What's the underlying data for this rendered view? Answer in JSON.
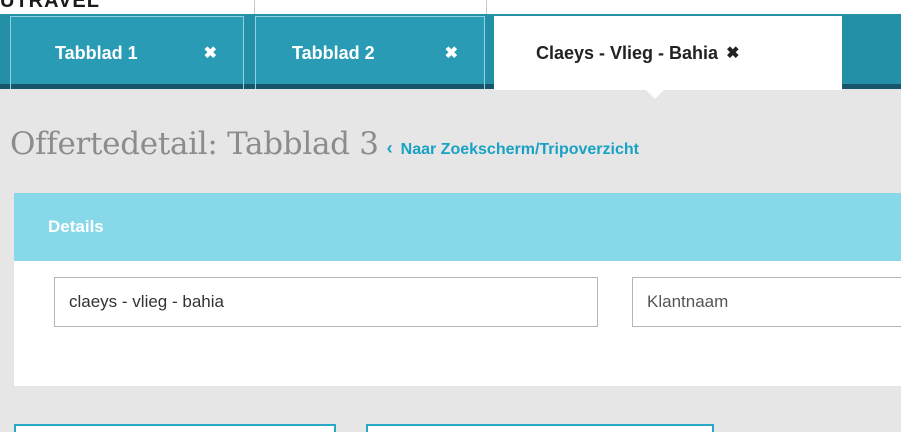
{
  "tabs": [
    {
      "label": "Tabblad 1",
      "close": "✖",
      "active": false
    },
    {
      "label": "Tabblad 2",
      "close": "✖",
      "active": false
    },
    {
      "label": "Claeys - Vlieg - Bahia",
      "close": "✖",
      "active": true
    }
  ],
  "heading": {
    "title": "Offertedetail: Tabblad 3",
    "back_icon": "‹",
    "back_link": "Naar Zoekscherm/Tripoverzicht"
  },
  "details": {
    "header": "Details",
    "name_field": {
      "value": "claeys - vlieg - bahia",
      "placeholder": ""
    },
    "client_field": {
      "value": "",
      "placeholder": "Klantnaam"
    }
  },
  "colors": {
    "tabbar": "#2490a8",
    "accent_link": "#1aa2c4",
    "panel_header": "#87d9ea"
  }
}
